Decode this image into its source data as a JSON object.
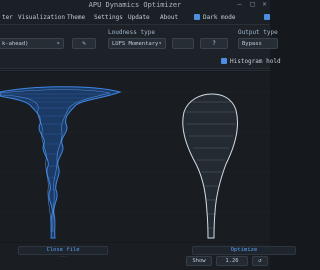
{
  "window": {
    "title": "APU Dynamics Optimizer"
  },
  "menu": {
    "items": [
      "ter",
      "Visualization",
      "Theme",
      "Settings",
      "Update",
      "About"
    ],
    "dark_mode_label": "Dark mode",
    "dark_mode_checked": true
  },
  "controls": {
    "preset_value": "k-ahead)",
    "edit_icon": "pencil-icon",
    "loudness_label": "Loudness type",
    "loudness_value": "LUFS Momentary",
    "mid_button": "",
    "help_icon": "help-circle-icon",
    "output_label": "Output type",
    "output_value": "Bypass",
    "histogram_label": "Histogram hold",
    "histogram_checked": true
  },
  "visualization": {
    "left_color": "#3f86e6",
    "right_color": "#c9d3de",
    "left_caption": "Close file",
    "left_sub": "···",
    "right_caption": "Optimize",
    "right_sub": "···"
  },
  "status": {
    "show_label": "Show",
    "zoom_value": "1.26"
  },
  "colors": {
    "accent": "#4c8fe0",
    "background": "#15191e"
  }
}
